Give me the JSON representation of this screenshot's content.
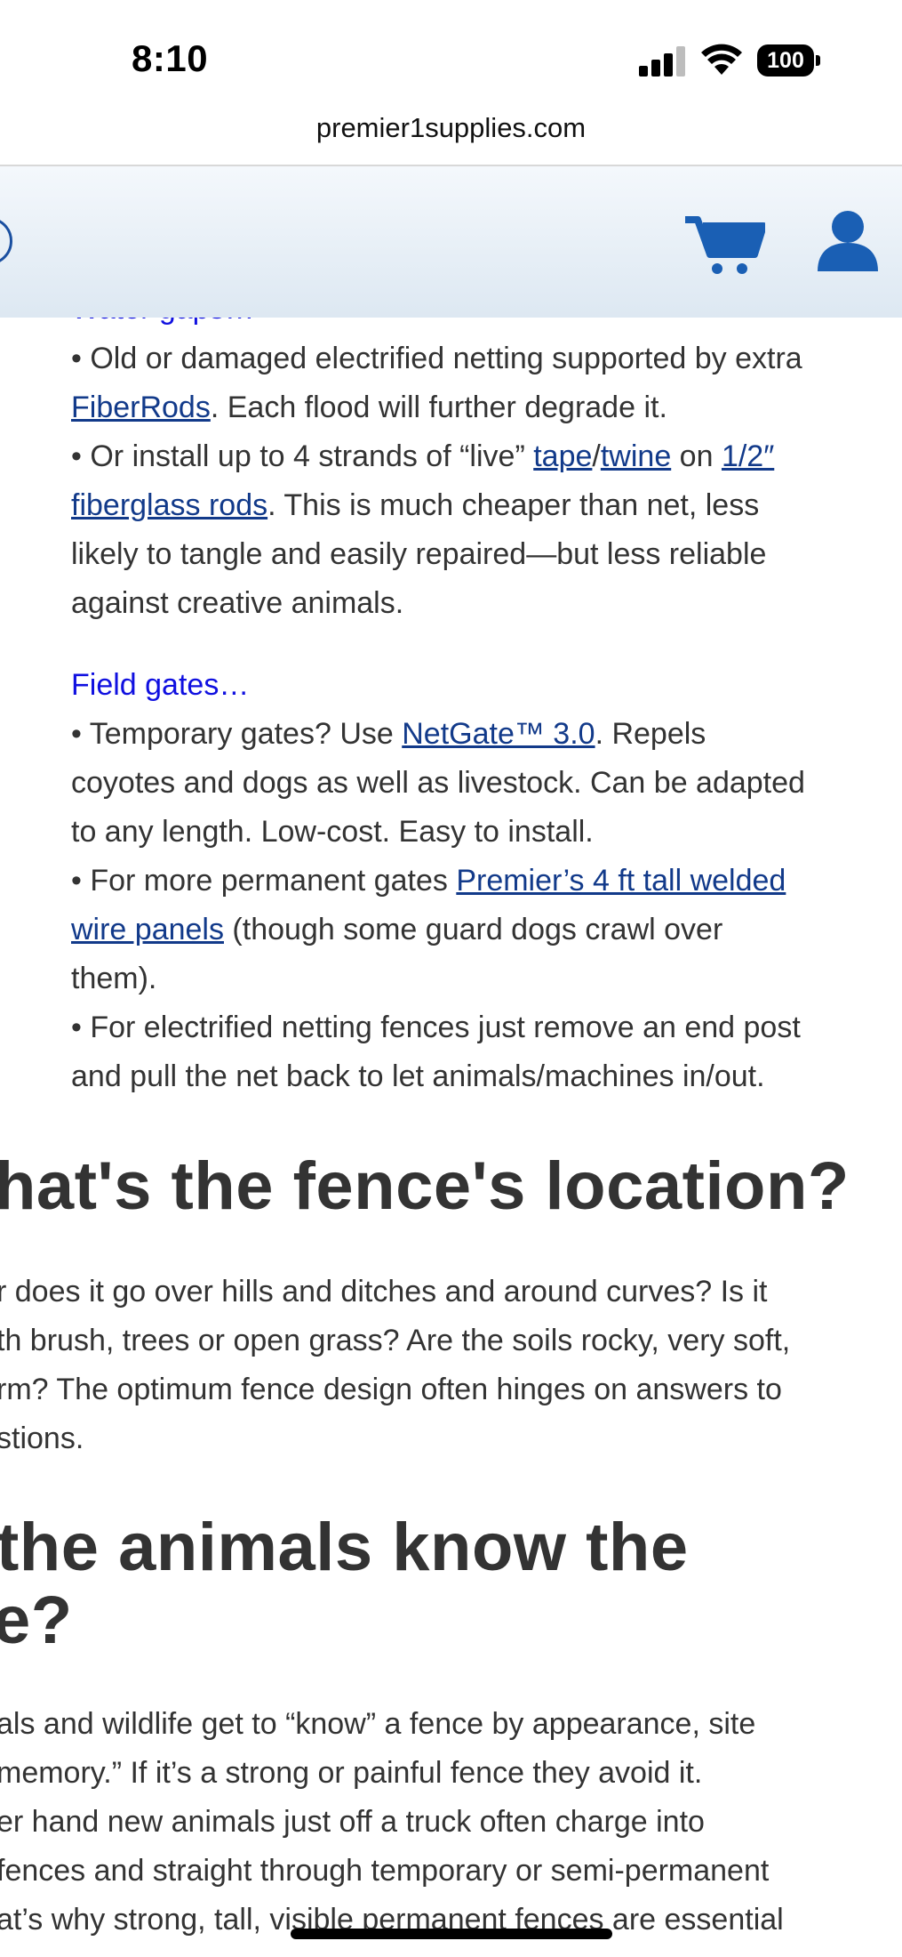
{
  "status_bar": {
    "time": "8:10",
    "battery": "100"
  },
  "browser": {
    "url": "premier1supplies.com"
  },
  "colors": {
    "link": "#123a8a",
    "heading": "#1010e0",
    "header_icon": "#1a5fb4",
    "text": "#333333"
  },
  "icons": {
    "cart": "cart-icon",
    "user": "user-icon"
  },
  "article": {
    "water_gaps_heading_partial": "Water gaps…",
    "water_gaps": {
      "b1_l1": "• Old or damaged electrified netting supported by extra",
      "b1_link": "FiberRods",
      "b1_l2_rest": ". Each flood will further degrade it.",
      "b2_l1_pre": "• Or install up to 4 strands of “live” ",
      "b2_link_tape": "tape",
      "b2_slash": "/",
      "b2_link_twine": "twine",
      "b2_on": " on ",
      "b2_link_rods_1": "1/2″",
      "b2_link_rods_2": "fiberglass rods",
      "b2_l2_rest": ". This is much cheaper than net, less",
      "b2_l3": "likely to tangle and easily repaired—but less reliable",
      "b2_l4": "against creative animals."
    },
    "field_gates": {
      "heading": "Field gates…",
      "b1_pre": "• Temporary gates? Use ",
      "b1_link": "NetGate™ 3.0",
      "b1_rest": ". Repels",
      "b1_l2": "coyotes and dogs as well as livestock. Can be adapted",
      "b1_l3": "to any length. Low-cost. Easy to install.",
      "b2_pre": "• For more permanent gates ",
      "b2_link_1": "Premier’s 4 ft tall welded",
      "b2_link_2": "wire panels",
      "b2_rest": " (though some guard dogs crawl over",
      "b2_l3": "them).",
      "b3_l1": "• For electrified netting fences just remove an end post",
      "b3_l2": "and pull the net back to let animals/machines in/out."
    },
    "location": {
      "heading": "hat's the fence's location?",
      "l1": "r does it go over hills and ditches and around curves? Is it",
      "l2": "th brush, trees or open grass? Are the soils rocky, very soft,",
      "l3": "rm? The optimum fence design often hinges on answers to",
      "l4": "stions."
    },
    "animals": {
      "heading_l1": " the animals know the",
      "heading_l2": "e?",
      "l1": "als and wildlife get to “know” a fence by appearance, site",
      "l2": "memory.” If it’s a strong or painful fence they avoid it.",
      "l3": "er hand new animals just off a truck often charge into",
      "l4": " fences and straight through temporary or semi-permanent",
      "l5": "at’s why strong, tall, visible permanent fences are essential"
    }
  }
}
